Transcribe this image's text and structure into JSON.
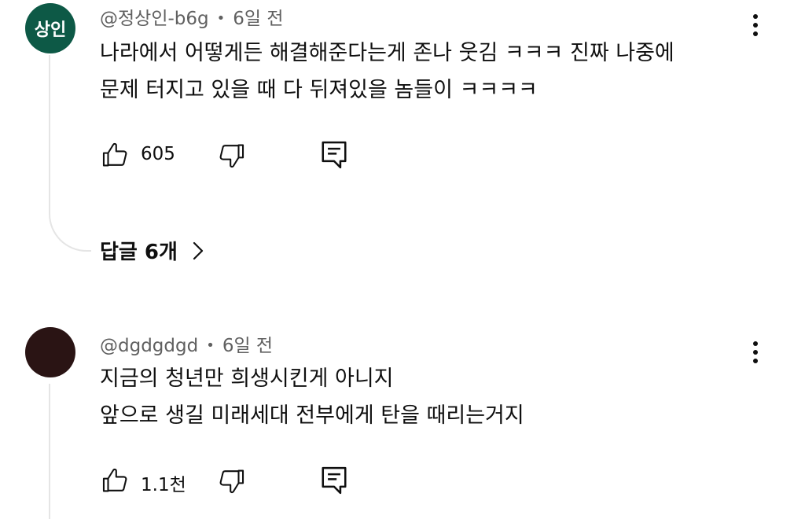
{
  "comments": [
    {
      "avatar_text": "상인",
      "avatar_color": "#0d5946",
      "author": "@정상인-b6g",
      "separator": "•",
      "time": "6일 전",
      "lines": [
        "나라에서 어떻게든 해결해준다는게 존나 웃김 ㅋㅋㅋ 진짜 나중에",
        "문제 터지고 있을 때 다 뒤져있을 놈들이 ㅋㅋㅋㅋ"
      ],
      "likes": "605",
      "replies_label": "답글 6개"
    },
    {
      "avatar_color": "#2a1414",
      "author": "@dgdgdgd",
      "separator": "•",
      "time": "6일 전",
      "lines": [
        "지금의 청년만 희생시킨게 아니지",
        "앞으로 생길 미래세대 전부에게 탄을 때리는거지"
      ],
      "likes": "1.1천"
    }
  ],
  "icons": {
    "like": "thumbs-up-icon",
    "dislike": "thumbs-down-icon",
    "reply": "comment-icon",
    "more": "more-vertical-icon",
    "expand": "chevron-right-icon"
  }
}
